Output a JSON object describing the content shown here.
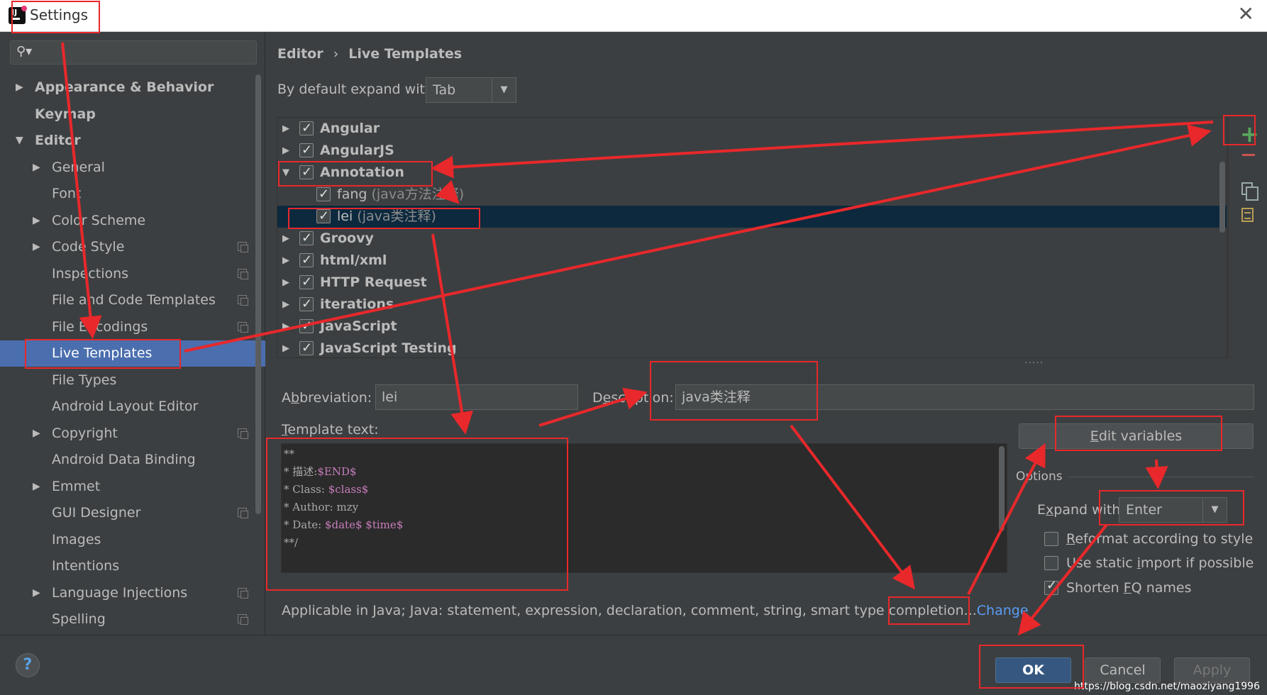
{
  "window": {
    "title": "Settings",
    "close_glyph": "✕"
  },
  "search": {
    "icon": "search-icon",
    "glyph": "⚲▾"
  },
  "sidebar": {
    "items": [
      {
        "label": "Appearance & Behavior",
        "arrow": "▶",
        "bold": true
      },
      {
        "label": "Keymap",
        "arrow": "",
        "bold": true
      },
      {
        "label": "Editor",
        "arrow": "▼",
        "bold": true
      },
      {
        "label": "General",
        "arrow": "▶"
      },
      {
        "label": "Font",
        "arrow": ""
      },
      {
        "label": "Color Scheme",
        "arrow": "▶"
      },
      {
        "label": "Code Style",
        "arrow": "▶",
        "icon": true
      },
      {
        "label": "Inspections",
        "arrow": "",
        "icon": true
      },
      {
        "label": "File and Code Templates",
        "arrow": "",
        "icon": true
      },
      {
        "label": "File Encodings",
        "arrow": "",
        "icon": true
      },
      {
        "label": "Live Templates",
        "arrow": "",
        "selected": true
      },
      {
        "label": "File Types",
        "arrow": ""
      },
      {
        "label": "Android Layout Editor",
        "arrow": ""
      },
      {
        "label": "Copyright",
        "arrow": "▶",
        "icon": true
      },
      {
        "label": "Android Data Binding",
        "arrow": ""
      },
      {
        "label": "Emmet",
        "arrow": "▶"
      },
      {
        "label": "GUI Designer",
        "arrow": "",
        "icon": true
      },
      {
        "label": "Images",
        "arrow": ""
      },
      {
        "label": "Intentions",
        "arrow": ""
      },
      {
        "label": "Language Injections",
        "arrow": "▶",
        "icon": true
      },
      {
        "label": "Spelling",
        "arrow": "",
        "icon": true
      }
    ]
  },
  "breadcrumb": {
    "parent": "Editor",
    "separator": "›",
    "current": "Live Templates"
  },
  "default_expand": {
    "label": "By default expand with",
    "value": "Tab",
    "arrow": "▼"
  },
  "templates": [
    {
      "label": "Angular",
      "group": true,
      "arrow": "▶",
      "checked": true
    },
    {
      "label": "AngularJS",
      "group": true,
      "arrow": "▶",
      "checked": true
    },
    {
      "label": "Annotation",
      "group": true,
      "arrow": "▼",
      "checked": true
    },
    {
      "label": "fang",
      "desc": "(java方法注释)",
      "group": false,
      "checked": true
    },
    {
      "label": "lei",
      "desc": "(java类注释)",
      "group": false,
      "checked": true,
      "selected": true
    },
    {
      "label": "Groovy",
      "group": true,
      "arrow": "▶",
      "checked": true
    },
    {
      "label": "html/xml",
      "group": true,
      "arrow": "▶",
      "checked": true
    },
    {
      "label": "HTTP Request",
      "group": true,
      "arrow": "▶",
      "checked": true
    },
    {
      "label": "iterations",
      "group": true,
      "arrow": "▶",
      "checked": true
    },
    {
      "label": "JavaScript",
      "group": true,
      "arrow": "▶",
      "checked": true
    },
    {
      "label": "JavaScript Testing",
      "group": true,
      "arrow": "▶",
      "checked": true
    }
  ],
  "toolbar": {
    "add": "+",
    "add_icon": "plus-icon",
    "remove_icon": "minus-icon",
    "copy_icon": "copy-icon",
    "group_icon": "document-icon"
  },
  "splitter": ".....",
  "abbreviation": {
    "label_pre": "A",
    "label_u": "b",
    "label_post": "breviation:",
    "value": "lei"
  },
  "description": {
    "label_pre": "D",
    "label_u": "e",
    "label_post": "scription:",
    "value": "java类注释"
  },
  "template_text": {
    "label_u": "T",
    "label_post": "emplate text:",
    "lines": [
      {
        "text": "**"
      },
      {
        "text": "* 描述:",
        "var": "$END$"
      },
      {
        "text": "* Class: ",
        "var": "$class$"
      },
      {
        "text": "* Author: mzy"
      },
      {
        "text": "* Date: ",
        "var": "$date$ $time$"
      },
      {
        "text": "**/"
      }
    ]
  },
  "edit_variables": {
    "label_u": "E",
    "label_post": "dit variables"
  },
  "options": {
    "title": "Options",
    "expand_label_pre": "E",
    "expand_label_u": "x",
    "expand_label_post": "pand with",
    "expand_value": "Enter",
    "expand_arrow": "▼",
    "reformat": {
      "pre": "",
      "u": "R",
      "post": "eformat according to style",
      "checked": false
    },
    "static_import": {
      "pre": "Use static ",
      "u": "i",
      "post": "mport if possible",
      "checked": false
    },
    "shorten": {
      "pre": "Shorten ",
      "u": "F",
      "post": "Q names",
      "checked": true
    }
  },
  "applicable": {
    "text": "Applicable in Java; Java: statement, expression, declaration, comment, string, smart type completion...",
    "link": "Change"
  },
  "footer": {
    "help": "?",
    "ok": "OK",
    "cancel": "Cancel",
    "apply": "Apply",
    "watermark": "https://blog.csdn.net/maoziyang1996"
  },
  "annotation_color": "#e8282b"
}
